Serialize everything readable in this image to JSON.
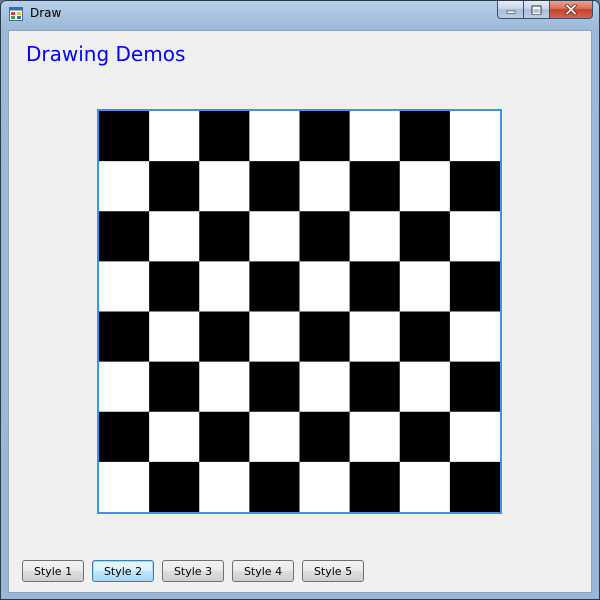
{
  "window": {
    "title": "Draw",
    "icon": "app-form-icon",
    "caption_buttons": [
      "minimize-icon",
      "maximize-icon",
      "close-icon"
    ]
  },
  "heading": {
    "text": "Drawing Demos",
    "color": "#0000ff"
  },
  "board": {
    "rows": 8,
    "cols": 8,
    "first_square": "black",
    "dark_color": "#000000",
    "light_color": "#ffffff",
    "border_color": "#3d93e6"
  },
  "buttons": [
    {
      "label": "Style 1",
      "focused": false
    },
    {
      "label": "Style 2",
      "focused": true
    },
    {
      "label": "Style 3",
      "focused": false
    },
    {
      "label": "Style 4",
      "focused": false
    },
    {
      "label": "Style 5",
      "focused": false
    }
  ]
}
